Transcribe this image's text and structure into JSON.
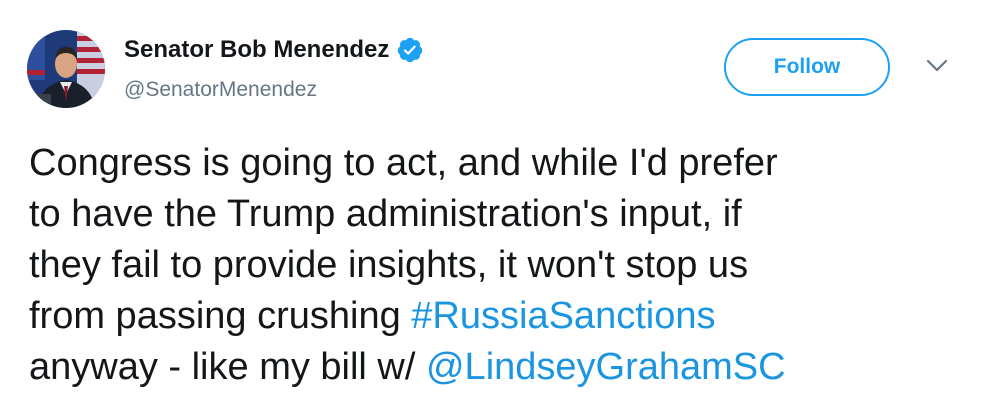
{
  "author": {
    "display_name": "Senator Bob Menendez",
    "handle": "@SenatorMenendez",
    "verified": true,
    "avatar": "avatar-photo"
  },
  "actions": {
    "follow_label": "Follow",
    "menu_icon": "chevron-down-icon"
  },
  "tweet": {
    "line1": "Congress is going to act, and while I'd prefer",
    "line2": "to have the Trump administration's input, if",
    "line3": "they fail to provide insights, it won't stop us",
    "line4_text": "from passing crushing ",
    "hashtag": "#RussiaSanctions",
    "line5_text": "anyway - like my bill w/ ",
    "mention": "@LindseyGrahamSC"
  },
  "colors": {
    "accent": "#1da1f2",
    "link": "#1b95e0",
    "text": "#14171a",
    "secondary_text": "#657786"
  }
}
